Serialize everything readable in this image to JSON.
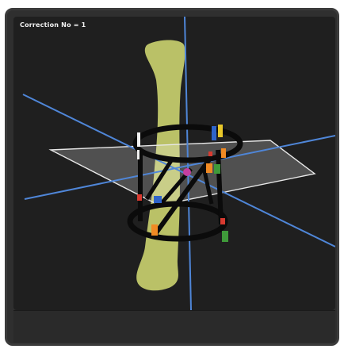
{
  "viewport": {
    "label": "Correction No = 1"
  },
  "colors": {
    "bone": "#c8cf6e",
    "axis": "#4f86d8",
    "ring": "#0b0b0b",
    "plane": "#e8e8e8",
    "strut_orange": "#f08a24",
    "strut_blue": "#2f64c9",
    "strut_green": "#3f9a3a",
    "strut_red": "#d83a30",
    "marker_yellow": "#e8c72a",
    "marker_pink": "#c43fa0"
  },
  "icons": {
    "bone": "tibia-bone-model",
    "frame": "circular-external-fixator"
  }
}
